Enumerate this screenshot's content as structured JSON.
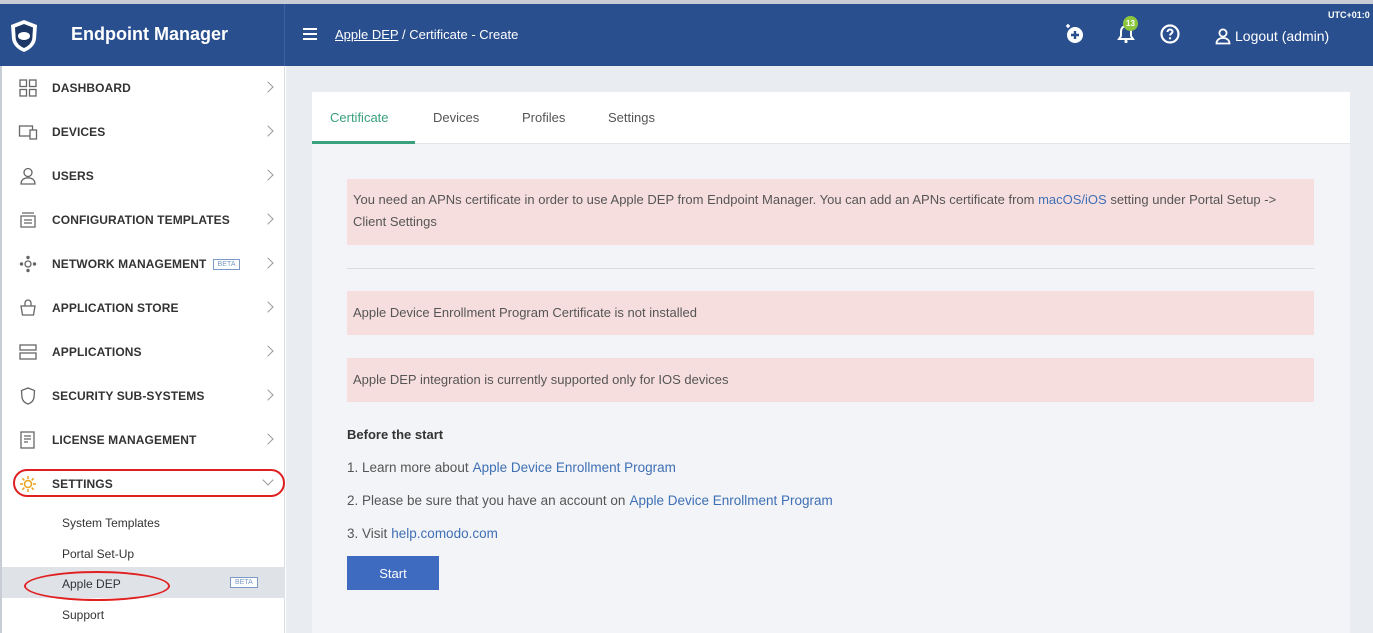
{
  "header": {
    "brand": "Endpoint Manager",
    "breadcrumb_link": "Apple DEP",
    "breadcrumb_separator": " / ",
    "breadcrumb_current": "Certificate - Create",
    "notification_count": "13",
    "logout_label": "Logout (admin)",
    "timezone": "UTC+01:0"
  },
  "sidebar": {
    "items": [
      {
        "label": "DASHBOARD",
        "icon": "dashboard-icon"
      },
      {
        "label": "DEVICES",
        "icon": "devices-icon"
      },
      {
        "label": "USERS",
        "icon": "user-icon"
      },
      {
        "label": "CONFIGURATION TEMPLATES",
        "icon": "templates-icon"
      },
      {
        "label": "NETWORK MANAGEMENT",
        "icon": "network-icon",
        "badge": "BETA"
      },
      {
        "label": "APPLICATION STORE",
        "icon": "store-icon"
      },
      {
        "label": "APPLICATIONS",
        "icon": "applications-icon"
      },
      {
        "label": "SECURITY SUB-SYSTEMS",
        "icon": "shield-icon"
      },
      {
        "label": "LICENSE MANAGEMENT",
        "icon": "license-icon"
      },
      {
        "label": "SETTINGS",
        "icon": "gear-icon"
      }
    ],
    "sub_items": [
      {
        "label": "System Templates"
      },
      {
        "label": "Portal Set-Up"
      },
      {
        "label": "Apple DEP",
        "badge": "BETA"
      },
      {
        "label": "Support"
      }
    ]
  },
  "tabs": [
    "Certificate",
    "Devices",
    "Profiles",
    "Settings"
  ],
  "alerts": {
    "apns_text_before": "You need an APNs certificate in order to use Apple DEP from Endpoint Manager. You can add an APNs certificate from ",
    "apns_link": "macOS/iOS",
    "apns_text_after": " setting under Portal Setup -> Client Settings",
    "not_installed": "Apple Device Enrollment Program Certificate is not installed",
    "ios_only": "Apple DEP integration is currently supported only for IOS devices"
  },
  "before_start": {
    "heading": "Before the start",
    "steps": [
      {
        "text": "1. Learn more about",
        "link": "Apple Device Enrollment Program"
      },
      {
        "text": "2. Please be sure that you have an account on",
        "link": "Apple Device Enrollment Program"
      },
      {
        "text": "3. Visit",
        "link": "help.comodo.com"
      }
    ],
    "start_button": "Start"
  },
  "colors": {
    "header_bg": "#2a4f8f",
    "accent_green": "#3aa17e",
    "alert_bg": "#f7dede",
    "link": "#3f6fb5",
    "button": "#3e6bbf",
    "highlight_ring": "#e02020"
  }
}
